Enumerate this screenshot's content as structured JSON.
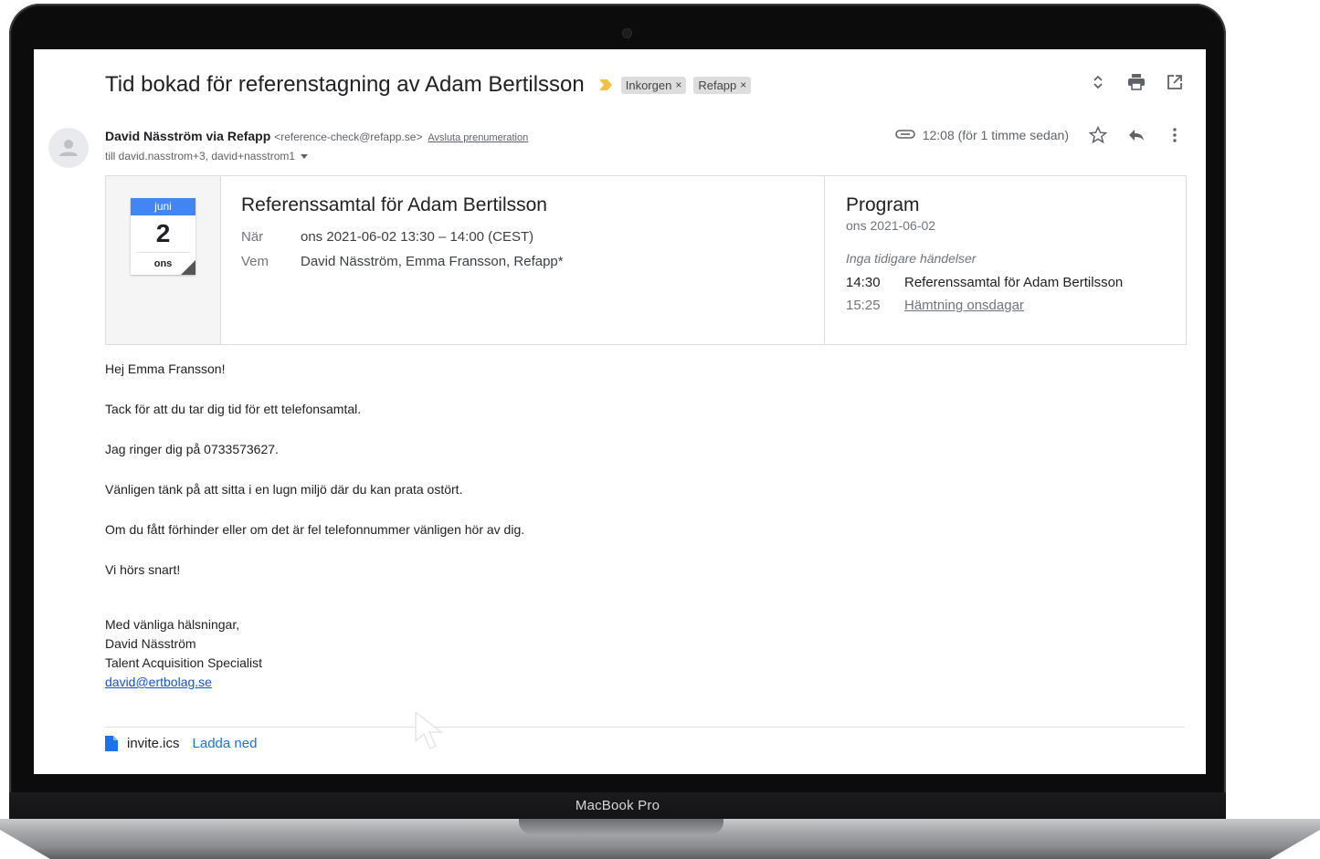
{
  "device": {
    "label": "MacBook Pro"
  },
  "email": {
    "subject": "Tid bokad för referenstagning av Adam Bertilsson",
    "labels": [
      {
        "name": "Inkorgen",
        "remove": "×"
      },
      {
        "name": "Refapp",
        "remove": "×"
      }
    ],
    "sender": {
      "name": "David Näsström via Refapp",
      "email": "<reference-check@refapp.se>",
      "unsubscribe": "Avsluta prenumeration"
    },
    "recipients": "till david.nasstrom+3, david+nasstrom1",
    "time": "12:08 (för 1 timme sedan)"
  },
  "invite": {
    "calendar": {
      "month": "juni",
      "day": "2",
      "weekday": "ons"
    },
    "title": "Referenssamtal för Adam Bertilsson",
    "when_label": "När",
    "when_value": "ons 2021-06-02 13:30 – 14:00 (CEST)",
    "who_label": "Vem",
    "who_value": "David Näsström, Emma Fransson, Refapp*",
    "program": {
      "title": "Program",
      "date": "ons 2021-06-02",
      "no_earlier": "Inga tidigare händelser",
      "items": [
        {
          "time": "14:30",
          "text": "Referenssamtal för Adam Bertilsson"
        },
        {
          "time": "15:25",
          "text": "Hämtning onsdagar"
        }
      ]
    }
  },
  "body": {
    "lines": [
      "Hej Emma Fransson!",
      "Tack för att du tar dig tid för ett telefonsamtal.",
      "Jag ringer dig på 0733573627.",
      "Vänligen tänk på att sitta i en lugn miljö där du kan prata ostört.",
      "Om du fått förhinder eller om det är fel telefonnummer vänligen hör av dig.",
      "Vi hörs snart!"
    ],
    "signature": {
      "greeting": "Med vänliga hälsningar,",
      "name": "David Näsström",
      "role": "Talent Acquisition Specialist",
      "email": "david@ertbolag.se"
    }
  },
  "attachment": {
    "filename": "invite.ics",
    "download": "Ladda ned"
  },
  "colors": {
    "accent": "#4285f4",
    "important": "#f4c142",
    "link": "#1a73e8"
  }
}
